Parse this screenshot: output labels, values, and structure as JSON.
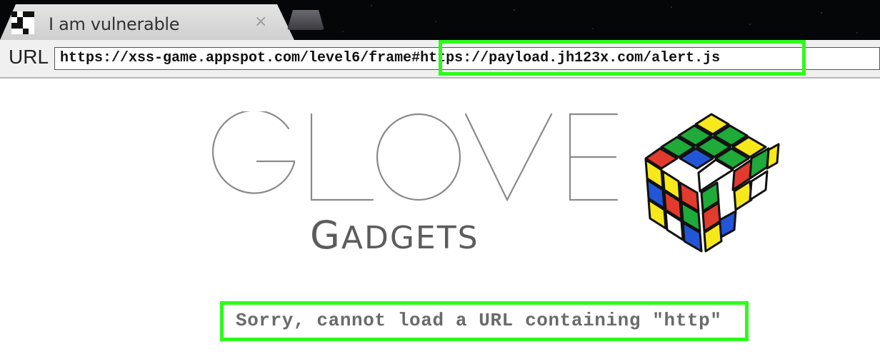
{
  "browser": {
    "tab_title": "I am vulnerable",
    "tab_close_glyph": "×",
    "url_label": "URL",
    "url_value": "https://xss-game.appspot.com/level6/frame#https://payload.jh123x.com/alert.js"
  },
  "page": {
    "logo_word": "GLOVE",
    "logo_sub_initial": "G",
    "logo_sub_rest": "ADGETS",
    "logo_image": "rubiks-cube",
    "error_message": "Sorry, cannot load a URL containing \"http\""
  },
  "colors": {
    "highlight": "#2dfb1c",
    "tab_strip": "#050608"
  }
}
